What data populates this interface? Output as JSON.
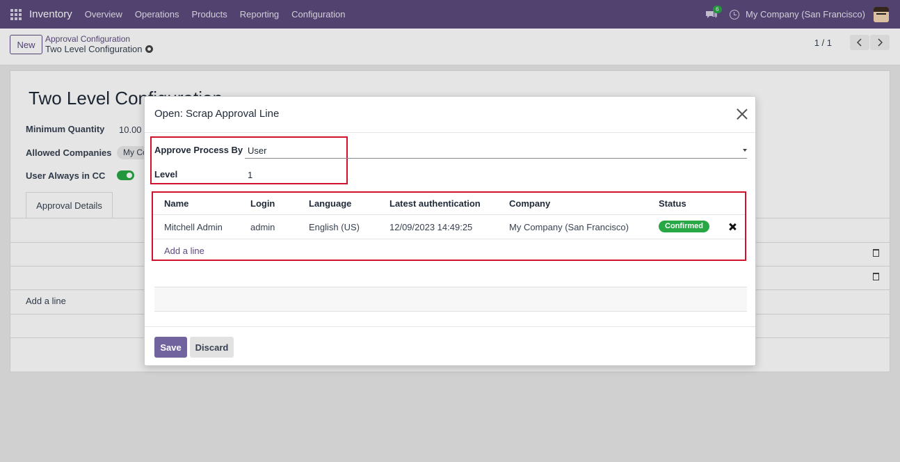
{
  "navbar": {
    "app_name": "Inventory",
    "menu": [
      "Overview",
      "Operations",
      "Products",
      "Reporting",
      "Configuration"
    ],
    "message_count": "6",
    "company": "My Company (San Francisco)"
  },
  "control_panel": {
    "new_label": "New",
    "breadcrumb_parent": "Approval Configuration",
    "breadcrumb_current": "Two Level Configuration",
    "pager": "1 / 1"
  },
  "form": {
    "title": "Two Level Configuration",
    "min_qty_label": "Minimum Quantity",
    "min_qty_value": "10.00",
    "allowed_companies_label": "Allowed Companies",
    "allowed_companies_tag": "My Co",
    "cc_label": "User Always in CC",
    "cc_enabled": true,
    "tab_label": "Approval Details",
    "add_line": "Add a line"
  },
  "modal": {
    "title": "Open: Scrap Approval Line",
    "approve_by_label": "Approve Process By",
    "approve_by_value": "User",
    "level_label": "Level",
    "level_value": "1",
    "columns": [
      "Name",
      "Login",
      "Language",
      "Latest authentication",
      "Company",
      "Status"
    ],
    "rows": [
      {
        "name": "Mitchell Admin",
        "login": "admin",
        "language": "English (US)",
        "latest_auth": "12/09/2023 14:49:25",
        "company": "My Company (San Francisco)",
        "status": "Confirmed"
      }
    ],
    "add_line": "Add a line",
    "save_label": "Save",
    "discard_label": "Discard"
  },
  "colors": {
    "brand": "#5c4a7d",
    "highlight_box": "#d0112b",
    "status_confirmed": "#28a745"
  }
}
